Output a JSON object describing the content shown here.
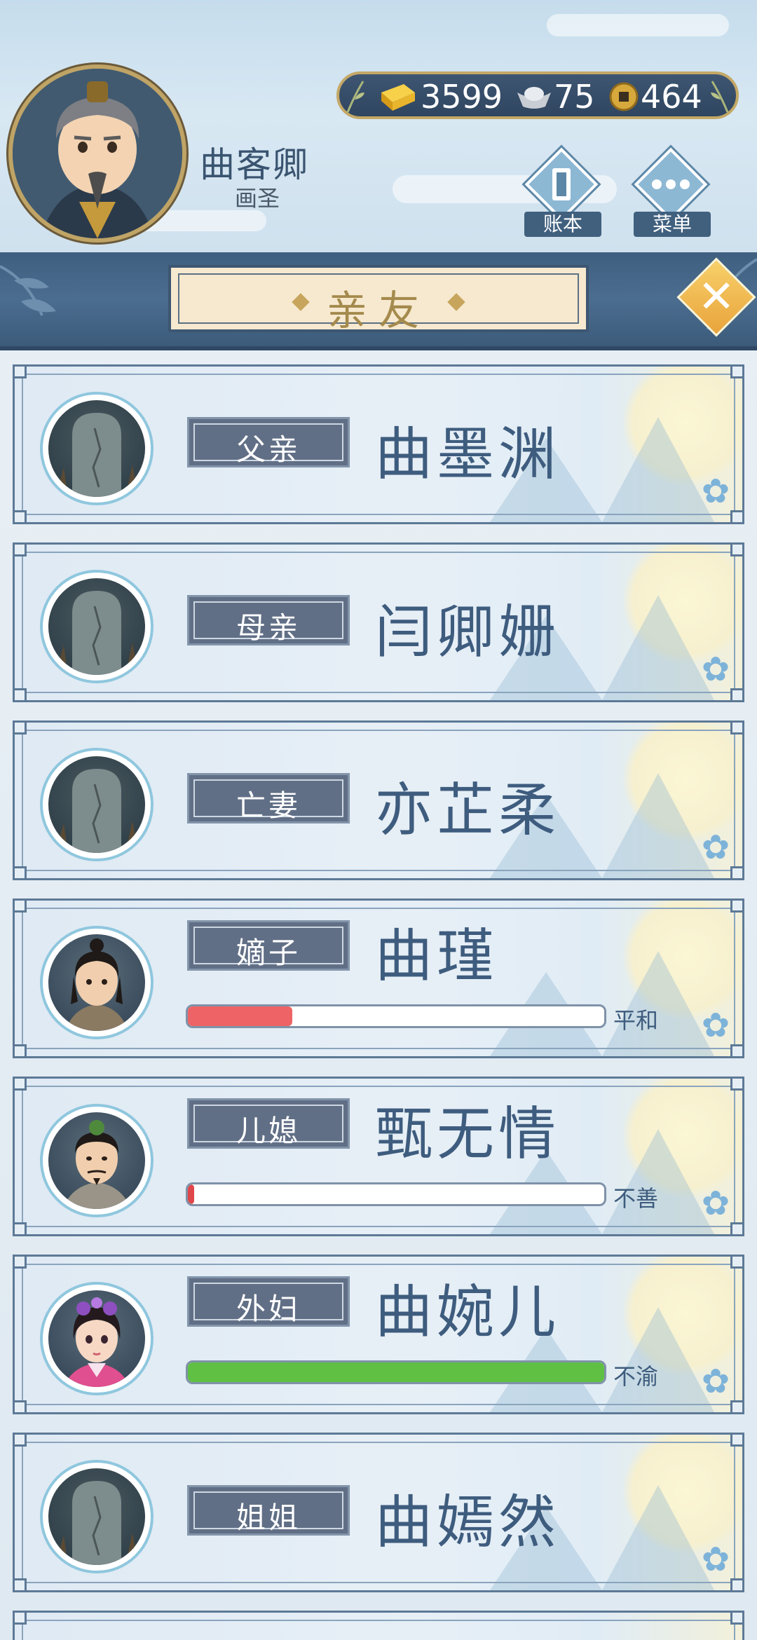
{
  "player": {
    "name": "曲客卿",
    "title": "画圣"
  },
  "currency": {
    "gold": "3599",
    "silver": "75",
    "coin": "464"
  },
  "header_buttons": {
    "ledger": "账本",
    "menu": "菜单"
  },
  "page_title": "亲友",
  "members": [
    {
      "relation": "父亲",
      "name": "曲墨渊",
      "deceased": true
    },
    {
      "relation": "母亲",
      "name": "闫卿姗",
      "deceased": true
    },
    {
      "relation": "亡妻",
      "name": "亦芷柔",
      "deceased": true
    },
    {
      "relation": "嫡子",
      "name": "曲瑾",
      "deceased": false,
      "mood": "平和",
      "mood_value": 0.25,
      "mood_color": "#ee6365"
    },
    {
      "relation": "儿媳",
      "name": "甄无情",
      "deceased": false,
      "mood": "不善",
      "mood_value": 0.015,
      "mood_color": "#e0474a"
    },
    {
      "relation": "外妇",
      "name": "曲婉儿",
      "deceased": false,
      "mood": "不渝",
      "mood_value": 1.0,
      "mood_color": "#5fc043"
    },
    {
      "relation": "姐姐",
      "name": "曲嫣然",
      "deceased": true
    }
  ],
  "colors": {
    "accent_navy": "#3f5f80",
    "name_text": "#3e5c7e",
    "gold_frame": "#c4a867"
  }
}
